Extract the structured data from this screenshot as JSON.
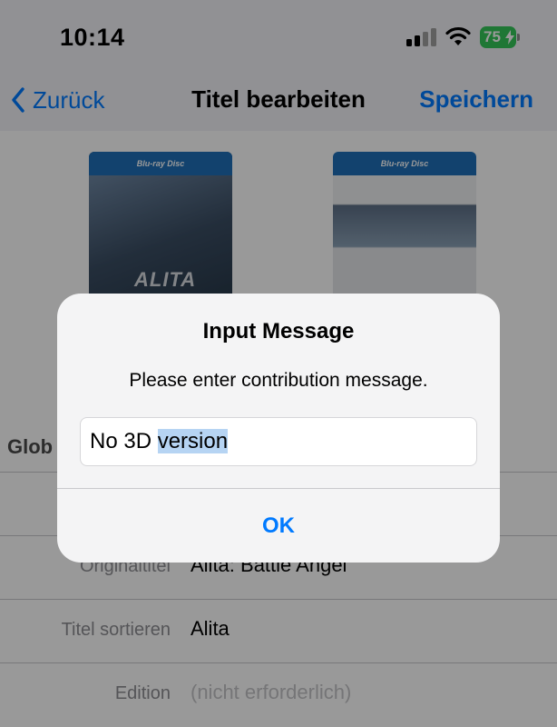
{
  "status": {
    "time": "10:14",
    "battery": "75"
  },
  "nav": {
    "back": "Zurück",
    "title": "Titel bearbeiten",
    "save": "Speichern"
  },
  "covers": {
    "front_band": "Blu-ray Disc",
    "front_logo": "ALITA",
    "back_band": "Blu-ray Disc"
  },
  "form": {
    "section": "Glob",
    "rows": [
      {
        "label": "",
        "value": ""
      },
      {
        "label": "Originaltitel",
        "value": "Alita: Battle Angel"
      },
      {
        "label": "Titel sortieren",
        "value": "Alita"
      },
      {
        "label": "Edition",
        "placeholder": "(nicht erforderlich)"
      }
    ]
  },
  "alert": {
    "title": "Input Message",
    "message": "Please enter contribution message.",
    "input_text_plain": "No 3D ",
    "input_text_selected": "version",
    "ok": "OK"
  },
  "colors": {
    "accent": "#007aff",
    "battery": "#34c759",
    "selection": "#b6d4f3"
  }
}
